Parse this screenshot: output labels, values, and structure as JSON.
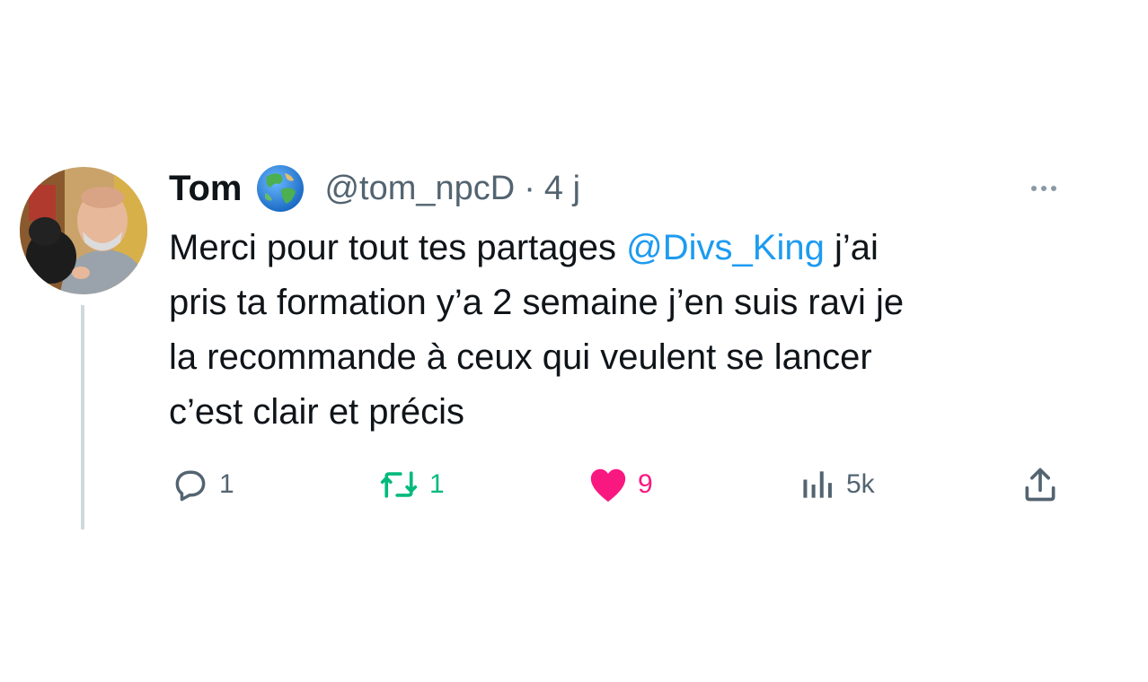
{
  "tweet": {
    "author": {
      "display_name": "Tom",
      "badge_icon": "globe-icon",
      "handle": "@tom_npcD",
      "separator": "·",
      "time": "4 j"
    },
    "text": {
      "line1_before": "Merci pour tout tes partages ",
      "mention": "@Divs_King",
      "line1_after": " j’ai",
      "line2": "pris ta formation y’a 2 semaine j’en suis ravi je",
      "line3": "la recommande à ceux qui veulent se lancer",
      "line4": "c’est clair et précis"
    },
    "actions": {
      "reply_count": "1",
      "retweet_count": "1",
      "like_count": "9",
      "views_count": "5k"
    },
    "colors": {
      "text": "#0f1419",
      "secondary": "#536471",
      "link": "#1d9bf0",
      "retweet": "#00ba7c",
      "like": "#f91880",
      "thread_line": "#cfd9de"
    }
  }
}
